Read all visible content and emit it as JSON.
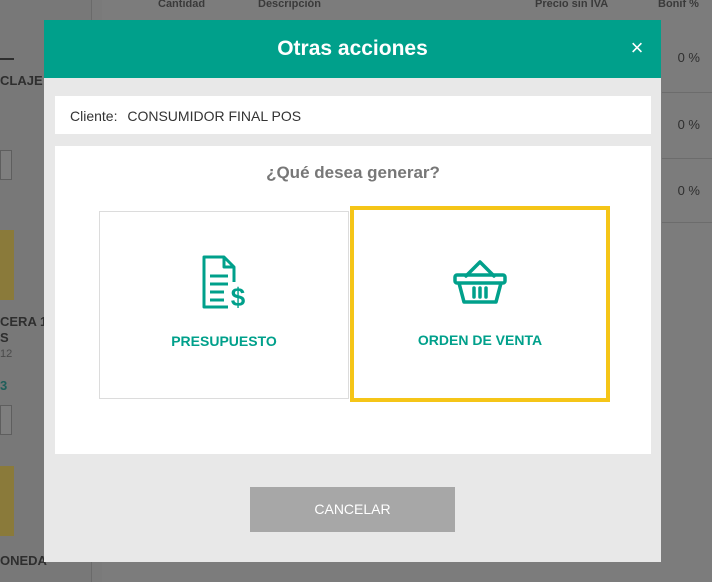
{
  "background": {
    "headers": [
      "Cantidad",
      "Descripción",
      "Precio sin IVA",
      "Bonif %"
    ],
    "left_fragments": [
      "CLAJE",
      "CERA 1",
      "S",
      "12",
      "3",
      "ONEDA"
    ],
    "percent_values": [
      "0 %",
      "0 %",
      "0 %"
    ]
  },
  "modal": {
    "title": "Otras acciones",
    "close_symbol": "×",
    "client_label": "Cliente:",
    "client_value": "CONSUMIDOR FINAL POS",
    "question": "¿Qué desea generar?",
    "options": [
      {
        "label": "PRESUPUESTO",
        "icon": "invoice-dollar-icon",
        "selected": false
      },
      {
        "label": "ORDEN DE VENTA",
        "icon": "shopping-basket-icon",
        "selected": true
      }
    ],
    "cancel_label": "CANCELAR"
  },
  "colors": {
    "accent": "#00a08b",
    "highlight": "#f5c518",
    "cancel": "#a7a7a7"
  }
}
